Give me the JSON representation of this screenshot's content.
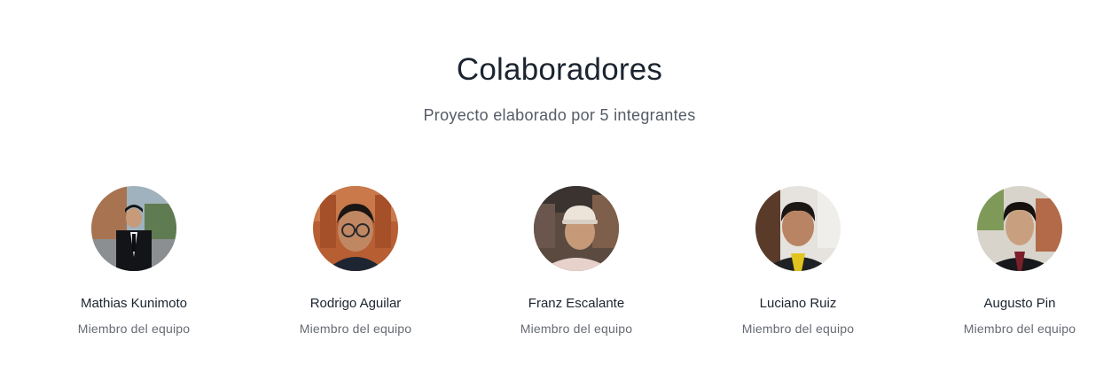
{
  "section": {
    "title": "Colaboradores",
    "subtitle": "Proyecto elaborado por 5 integrantes"
  },
  "members": [
    {
      "name": "Mathias Kunimoto",
      "role": "Miembro del equipo"
    },
    {
      "name": "Rodrigo Aguilar",
      "role": "Miembro del equipo"
    },
    {
      "name": "Franz Escalante",
      "role": "Miembro del equipo"
    },
    {
      "name": "Luciano Ruiz",
      "role": "Miembro del equipo"
    },
    {
      "name": "Augusto Pin",
      "role": "Miembro del equipo"
    }
  ],
  "colors": {
    "title": "#1b2430",
    "subtitle": "#555c66",
    "role": "#666b73",
    "background": "#ffffff"
  }
}
